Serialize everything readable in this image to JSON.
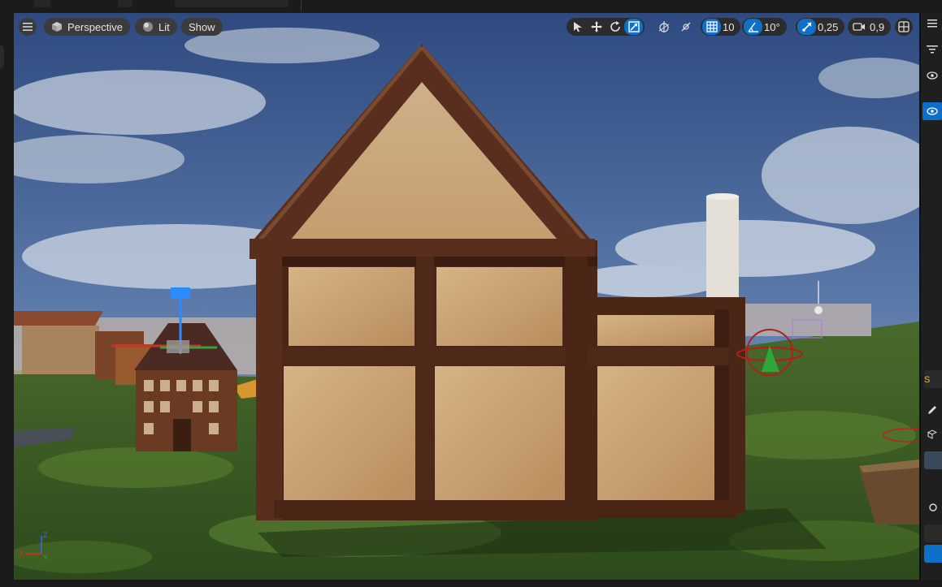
{
  "viewport": {
    "menu_icon": "hamburger-icon",
    "perspective_label": "Perspective",
    "lit_label": "Lit",
    "show_label": "Show"
  },
  "toolbar": {
    "grid_snap_value": "10",
    "rotation_snap_value": "10°",
    "scale_snap_value": "0,25",
    "camera_speed_value": "0,9"
  },
  "axis": {
    "x_label": "X",
    "y_label": "Y",
    "z_label": "Z"
  },
  "right_panel": {
    "letter": "S"
  },
  "colors": {
    "accent": "#0e70c8",
    "toolbar_bg": "#2c2c2c",
    "pill_bg": "#3b3b3b",
    "sky": "#3f5a8c",
    "ground": "#3f5a28",
    "timber": "#4a2616",
    "plaster": "#c9a377"
  }
}
